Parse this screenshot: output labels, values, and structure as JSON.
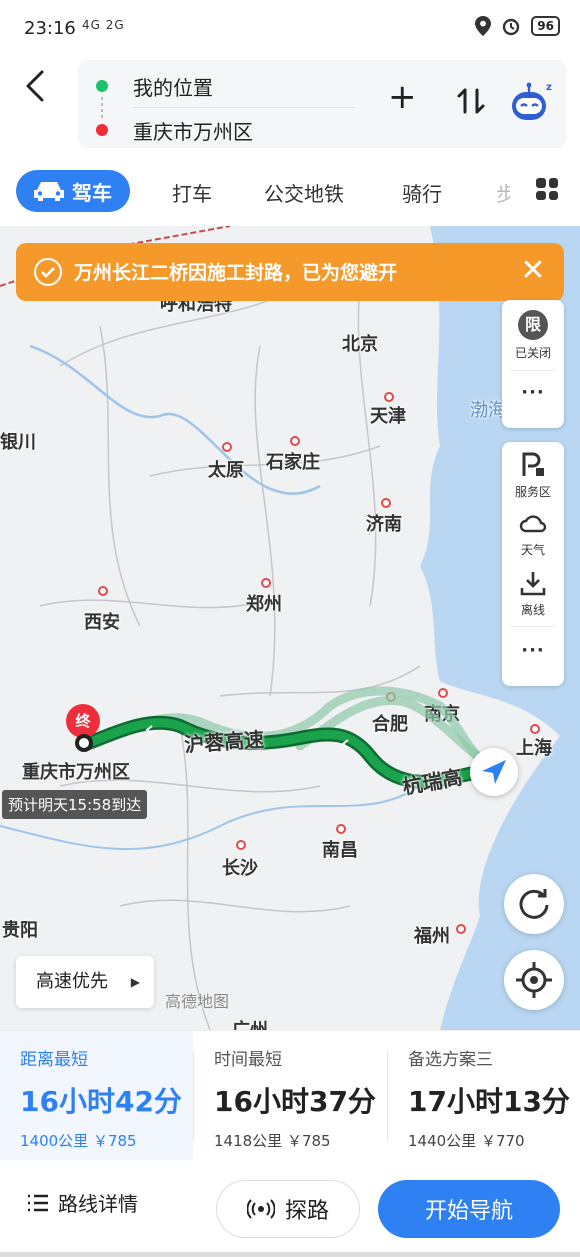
{
  "status": {
    "time": "23:16",
    "net": "4G 2G",
    "battery": "96"
  },
  "route": {
    "from": "我的位置",
    "to": "重庆市万州区"
  },
  "tabs": [
    {
      "label": "驾车"
    },
    {
      "label": "打车"
    },
    {
      "label": "公交地铁"
    },
    {
      "label": "骑行"
    },
    {
      "label": "步"
    }
  ],
  "notice": {
    "text": "万州长江二桥因施工封路，已为您避开"
  },
  "side_panel": {
    "limit_label": "已关闭",
    "limit_glyph": "限",
    "service_label": "服务区",
    "weather_label": "天气",
    "offline_label": "离线",
    "more": "···"
  },
  "map": {
    "cities": [
      {
        "name": "北京"
      },
      {
        "name": "天津"
      },
      {
        "name": "太原"
      },
      {
        "name": "石家庄"
      },
      {
        "name": "济南"
      },
      {
        "name": "郑州"
      },
      {
        "name": "西安"
      },
      {
        "name": "合肥"
      },
      {
        "name": "南京"
      },
      {
        "name": "上海"
      },
      {
        "name": "南昌"
      },
      {
        "name": "长沙"
      },
      {
        "name": "福州"
      },
      {
        "name": "贵阳"
      },
      {
        "name": "渤海"
      },
      {
        "name": "呼和浩特"
      },
      {
        "name": "银川"
      },
      {
        "name": "重庆"
      },
      {
        "name": "广州"
      }
    ],
    "destination_badge": "终",
    "destination_name": "重庆市万州区",
    "road1": "沪蓉高速",
    "road2": "杭瑞高",
    "eta": "预计明天15:58到达",
    "hw_pref": "高速优先",
    "watermark": "高德地图"
  },
  "options": [
    {
      "title": "距离最短",
      "time": "16小时42分",
      "info": "1400公里 ￥785",
      "selected": true
    },
    {
      "title": "时间最短",
      "time": "16小时37分",
      "info": "1418公里 ￥785",
      "selected": false
    },
    {
      "title": "备选方案三",
      "time": "17小时13分",
      "info": "1440公里 ￥770",
      "selected": false
    }
  ],
  "bottom": {
    "details": "路线详情",
    "probe": "探路",
    "start": "开始导航"
  },
  "colors": {
    "accent": "#2f80f3",
    "route": "#1aa34a",
    "notice": "#f59a2a"
  }
}
